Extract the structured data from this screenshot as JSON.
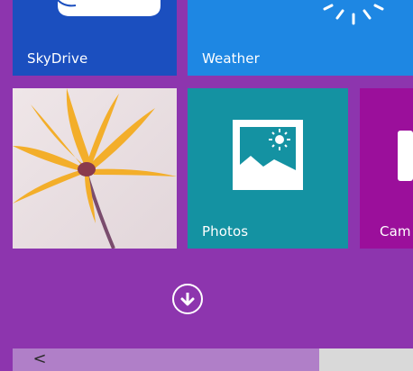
{
  "tiles": {
    "skydrive": {
      "label": "SkyDrive",
      "icon": "cloud-icon",
      "color": "#1b4fbf"
    },
    "weather": {
      "label": "Weather",
      "icon": "sun-icon",
      "color": "#1e87e3"
    },
    "flower": {
      "icon": "flower-photo",
      "color": "#e9dfe2"
    },
    "photos": {
      "label": "Photos",
      "icon": "photo-icon",
      "color": "#1492a2"
    },
    "camera": {
      "label": "Cam",
      "icon": "camera-icon",
      "color": "#9b0f9b"
    }
  },
  "controls": {
    "download_icon": "arrow-down-circle-icon",
    "scroll_left_glyph": "<"
  },
  "colors": {
    "background": "#8d35ae",
    "scrollbar_thumb": "#b07fc8",
    "scrollbar_track": "#d9d9d9"
  }
}
